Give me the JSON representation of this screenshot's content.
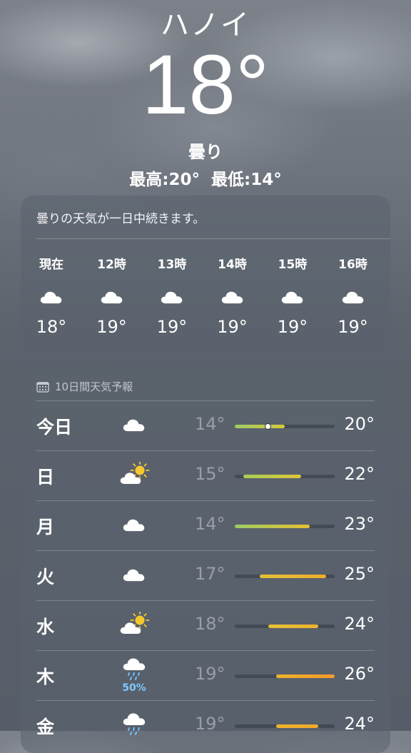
{
  "header": {
    "city": "ハノイ",
    "temperature": "18°",
    "condition": "曇り",
    "high": "最高:20°",
    "low": "最低:14°"
  },
  "hourly": {
    "summary": "曇りの天気が一日中続きます。",
    "items": [
      {
        "label": "現在",
        "icon": "cloud-icon",
        "temp": "18°"
      },
      {
        "label": "12時",
        "icon": "cloud-icon",
        "temp": "19°"
      },
      {
        "label": "13時",
        "icon": "cloud-icon",
        "temp": "19°"
      },
      {
        "label": "14時",
        "icon": "cloud-icon",
        "temp": "19°"
      },
      {
        "label": "15時",
        "icon": "cloud-icon",
        "temp": "19°"
      },
      {
        "label": "16時",
        "icon": "cloud-icon",
        "temp": "19°"
      }
    ]
  },
  "daily": {
    "title": "10日間天気予報",
    "range_min": 14,
    "range_max": 26,
    "items": [
      {
        "day": "今日",
        "icon": "cloud-icon",
        "precip": "",
        "low": "14°",
        "high": "20°",
        "low_value": 14,
        "high_value": 20,
        "current_value": 18,
        "colors": [
          "#9ccc65",
          "#d9c93c"
        ]
      },
      {
        "day": "日",
        "icon": "partly-cloudy-icon",
        "precip": "",
        "low": "15°",
        "high": "22°",
        "low_value": 15,
        "high_value": 22,
        "current_value": null,
        "colors": [
          "#a6cf55",
          "#e0c43a"
        ]
      },
      {
        "day": "月",
        "icon": "cloud-icon",
        "precip": "",
        "low": "14°",
        "high": "23°",
        "low_value": 14,
        "high_value": 23,
        "current_value": null,
        "colors": [
          "#9ccc65",
          "#e6c032"
        ]
      },
      {
        "day": "火",
        "icon": "cloud-icon",
        "precip": "",
        "low": "17°",
        "high": "25°",
        "low_value": 17,
        "high_value": 25,
        "current_value": null,
        "colors": [
          "#e2c23a",
          "#f0ad2a"
        ]
      },
      {
        "day": "水",
        "icon": "partly-cloudy-icon",
        "precip": "",
        "low": "18°",
        "high": "24°",
        "low_value": 18,
        "high_value": 24,
        "current_value": null,
        "colors": [
          "#e6c237",
          "#efb12c"
        ]
      },
      {
        "day": "木",
        "icon": "rain-cloud-icon",
        "precip": "50%",
        "low": "19°",
        "high": "26°",
        "low_value": 19,
        "high_value": 26,
        "current_value": null,
        "colors": [
          "#efb32c",
          "#f29a2a"
        ]
      },
      {
        "day": "金",
        "icon": "rain-cloud-icon",
        "precip": "",
        "low": "19°",
        "high": "24°",
        "low_value": 19,
        "high_value": 24,
        "current_value": null,
        "colors": [
          "#efb32c",
          "#efaa2c"
        ]
      }
    ]
  }
}
